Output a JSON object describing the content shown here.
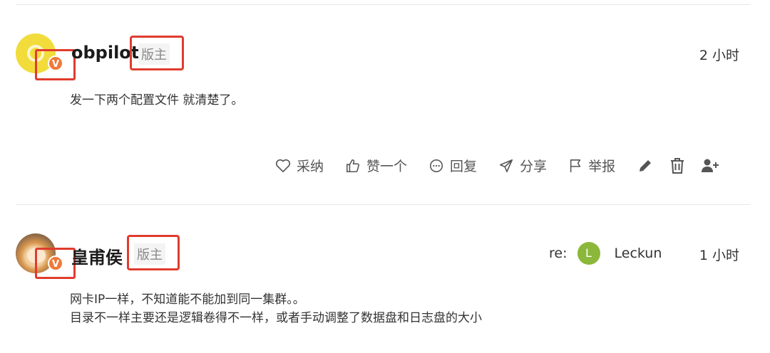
{
  "posts": [
    {
      "username": "obpilot",
      "role": "版主",
      "time": "2 小时",
      "badge": "V",
      "content": [
        "发一下两个配置文件 就清楚了。"
      ]
    },
    {
      "username": "皇甫侯",
      "role": "版主",
      "time": "1 小时",
      "badge": "V",
      "reply_prefix": "re:",
      "reply_initial": "L",
      "reply_user": "Leckun",
      "content": [
        "网卡IP一样，不知道能不能加到同一集群。。",
        "目录不一样主要还是逻辑卷得不一样，或者手动调整了数据盘和日志盘的大小"
      ]
    }
  ],
  "actions": {
    "accept": "采纳",
    "like": "赞一个",
    "reply": "回复",
    "share": "分享",
    "report": "举报"
  },
  "icons": [
    "heart-icon",
    "thumbs-up-icon",
    "comment-icon",
    "share-icon",
    "flag-icon",
    "pencil-icon",
    "trash-icon",
    "add-user-icon"
  ],
  "colors": {
    "highlight": "#e03c2d",
    "badge": "#ee7a3a",
    "avatar_yellow": "#f1dc3b",
    "mini_avatar": "#8bb83a"
  }
}
